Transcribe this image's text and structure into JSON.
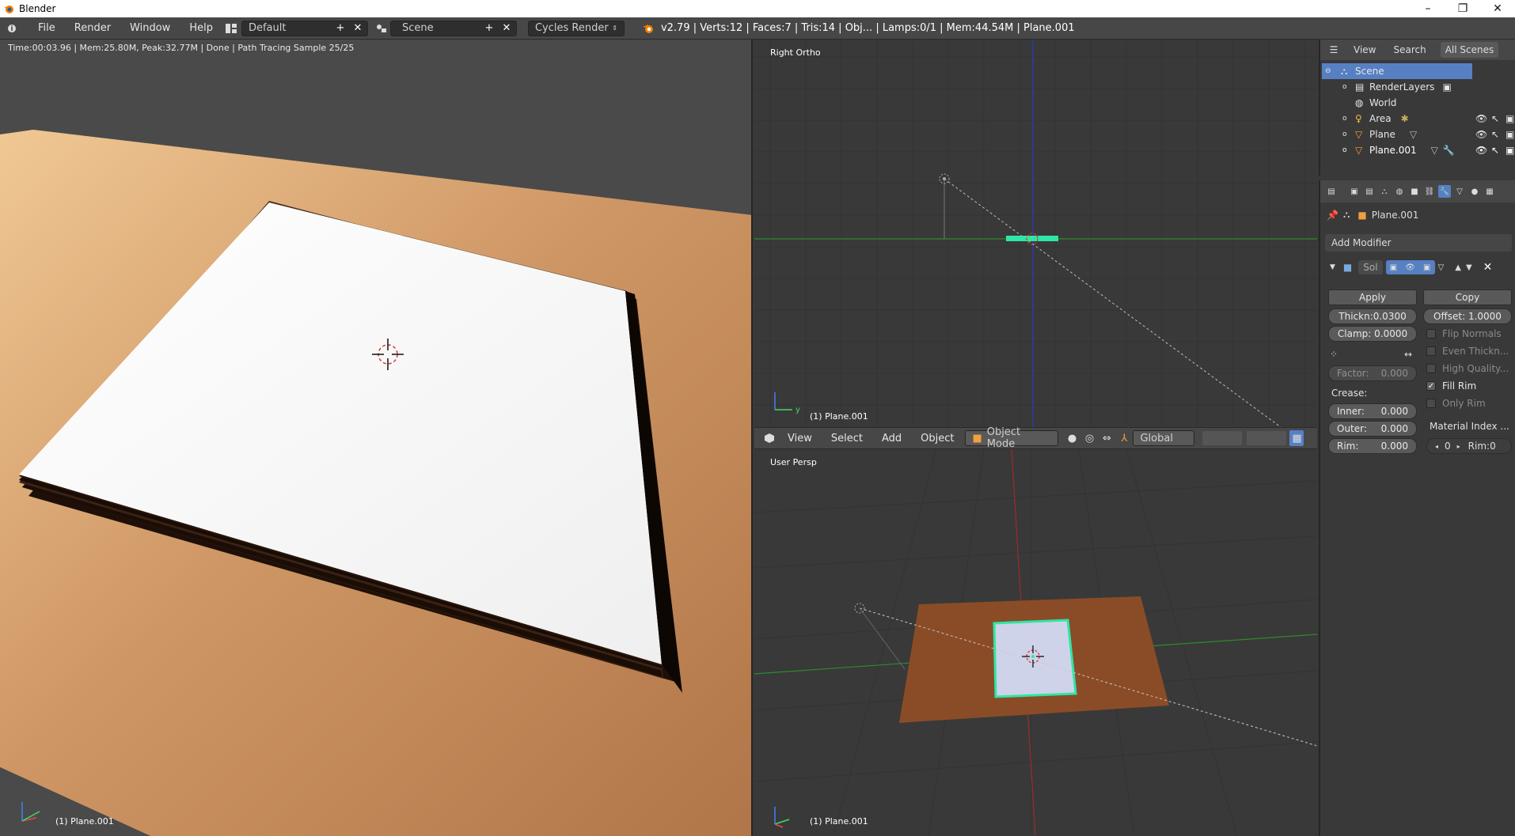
{
  "window": {
    "title": "Blender",
    "minimize": "–",
    "maximize": "❐",
    "close": "✕"
  },
  "info_header": {
    "menus": [
      "File",
      "Render",
      "Window",
      "Help"
    ],
    "layout": "Default",
    "scene": "Scene",
    "engine": "Cycles Render",
    "stats": "v2.79 | Verts:12 | Faces:7 | Tris:14 | Obj... | Lamps:0/1 | Mem:44.54M | Plane.001"
  },
  "render_view": {
    "status": "Time:00:03.96 | Mem:25.80M, Peak:32.77M | Done | Path Tracing Sample 25/25",
    "object_label": "(1) Plane.001"
  },
  "ortho_view": {
    "title": "Right Ortho",
    "object_label": "(1) Plane.001"
  },
  "view3d_header": {
    "menus": [
      "View",
      "Select",
      "Add",
      "Object"
    ],
    "mode": "Object Mode",
    "orientation": "Global"
  },
  "persp_view": {
    "title": "User Persp",
    "object_label": "(1) Plane.001"
  },
  "outliner": {
    "tabs": [
      "View",
      "Search",
      "All Scenes"
    ],
    "items": [
      {
        "label": "Scene",
        "icon": "scene-icon",
        "selected": true
      },
      {
        "label": "RenderLayers",
        "icon": "renderlayers-icon"
      },
      {
        "label": "World",
        "icon": "world-icon"
      },
      {
        "label": "Area",
        "icon": "lamp-icon"
      },
      {
        "label": "Plane",
        "icon": "mesh-icon"
      },
      {
        "label": "Plane.001",
        "icon": "mesh-icon",
        "active": true
      }
    ]
  },
  "properties": {
    "context_object": "Plane.001",
    "add_modifier": "Add Modifier",
    "modifier_name": "Sol",
    "apply": "Apply",
    "copy": "Copy",
    "thickness": "Thickn:0.0300",
    "offset": "Offset: 1.0000",
    "clamp": "Clamp: 0.0000",
    "factor_label": "Factor:",
    "factor_value": "0.000",
    "crease_label": "Crease:",
    "inner_label": "Inner:",
    "inner_value": "0.000",
    "outer_label": "Outer:",
    "outer_value": "0.000",
    "rim_label": "Rim:",
    "rim_value": "0.000",
    "material_index": "Material Index ...",
    "material_value": "0",
    "rim_index": "Rim:0",
    "options": [
      {
        "label": "Flip Normals",
        "checked": false
      },
      {
        "label": "Even Thickn...",
        "checked": false
      },
      {
        "label": "High Quality...",
        "checked": false
      },
      {
        "label": "Fill Rim",
        "checked": true
      },
      {
        "label": "Only Rim",
        "checked": false
      }
    ]
  },
  "colors": {
    "selection_blue": "#5680c2",
    "active_green": "#2fe6a6",
    "floor_orange": "#c99062"
  }
}
